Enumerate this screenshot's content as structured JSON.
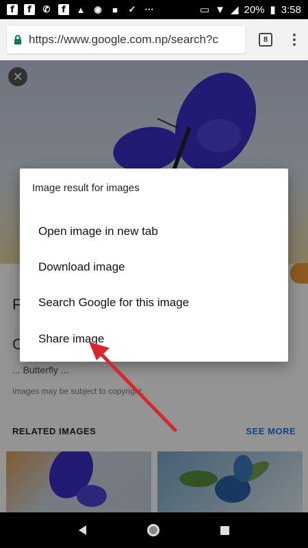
{
  "status_bar": {
    "left_icons": [
      "facebook-icon",
      "facebook-icon",
      "phone-forward-icon",
      "facebook-icon",
      "warning-icon",
      "messenger-icon",
      "video-icon",
      "check-icon",
      "more-icon"
    ],
    "battery_text": "20%",
    "time": "3:58"
  },
  "browser": {
    "url": "https://www.google.com.np/search?c",
    "tab_count": "8"
  },
  "page": {
    "title_line1": "F",
    "title_line2": "C",
    "snippet": "... Butterfly ...",
    "copyright_note": "Images may be subject to copyright.",
    "related_label": "RELATED IMAGES",
    "see_more_label": "SEE MORE"
  },
  "context_menu": {
    "title": "Image result for images",
    "items": [
      {
        "label": "Open image in new tab"
      },
      {
        "label": "Download image"
      },
      {
        "label": "Search Google for this image"
      },
      {
        "label": "Share image"
      }
    ]
  },
  "colors": {
    "accent": "#1a73e8",
    "annotation_arrow": "#d9252b",
    "butterfly": "#3b2fc9"
  }
}
